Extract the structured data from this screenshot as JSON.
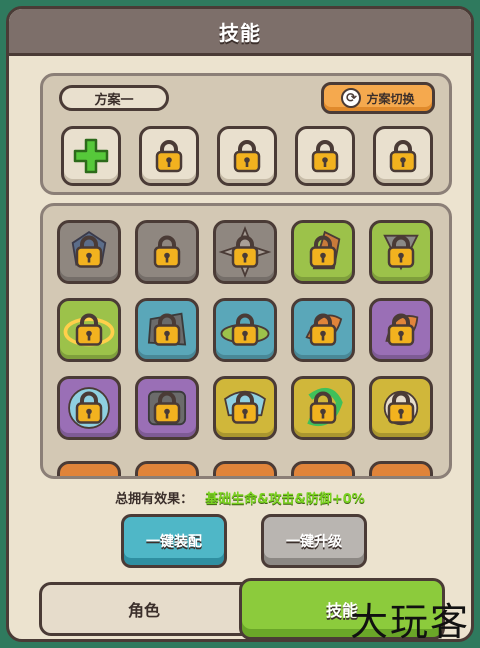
{
  "title": "技能",
  "scheme": {
    "label": "方案一",
    "switch_label": "方案切换"
  },
  "top_slots": [
    {
      "state": "add",
      "icon": "plus-icon"
    },
    {
      "state": "locked",
      "icon": "lock-icon"
    },
    {
      "state": "locked",
      "icon": "lock-icon"
    },
    {
      "state": "locked",
      "icon": "lock-icon"
    },
    {
      "state": "locked",
      "icon": "lock-icon"
    }
  ],
  "skill_grid": [
    {
      "bg": "#8f8780",
      "art": "gray-rocky-skill"
    },
    {
      "bg": "#8f8780",
      "art": "gray-lock-skill"
    },
    {
      "bg": "#8f8780",
      "art": "gray-star-skill"
    },
    {
      "bg": "#9cc24a",
      "art": "green-fire-skill"
    },
    {
      "bg": "#9cc24a",
      "art": "green-trident-skill"
    },
    {
      "bg": "#9cc24a",
      "art": "green-ring-skill"
    },
    {
      "bg": "#5aa7b9",
      "art": "teal-rock-skill"
    },
    {
      "bg": "#5aa7b9",
      "art": "teal-leaf-skill"
    },
    {
      "bg": "#5aa7b9",
      "art": "teal-flame-skill"
    },
    {
      "bg": "#9a6fb6",
      "art": "purple-fire-skill"
    },
    {
      "bg": "#9a6fb6",
      "art": "purple-gear-skill"
    },
    {
      "bg": "#9a6fb6",
      "art": "purple-rock-skill"
    },
    {
      "bg": "#d0b73a",
      "art": "gold-cloud-skill"
    },
    {
      "bg": "#d0b73a",
      "art": "gold-swirl-skill"
    },
    {
      "bg": "#d0b73a",
      "art": "gold-orb-skill"
    }
  ],
  "effect": {
    "label": "总拥有效果：",
    "value": "基础生命&攻击&防御+0%"
  },
  "buttons": {
    "equip": "一键装配",
    "upgrade": "一键升级"
  },
  "tabs": {
    "role": "角色",
    "skill": "技能"
  },
  "watermark": "大玩客",
  "colors": {
    "background": "#2f7a5e",
    "lock": "#f2b21f",
    "plus": "#56c83a",
    "effect_value": "#7ad321",
    "equip_button": "#4fb7c7",
    "active_tab": "#8ccb3c"
  }
}
